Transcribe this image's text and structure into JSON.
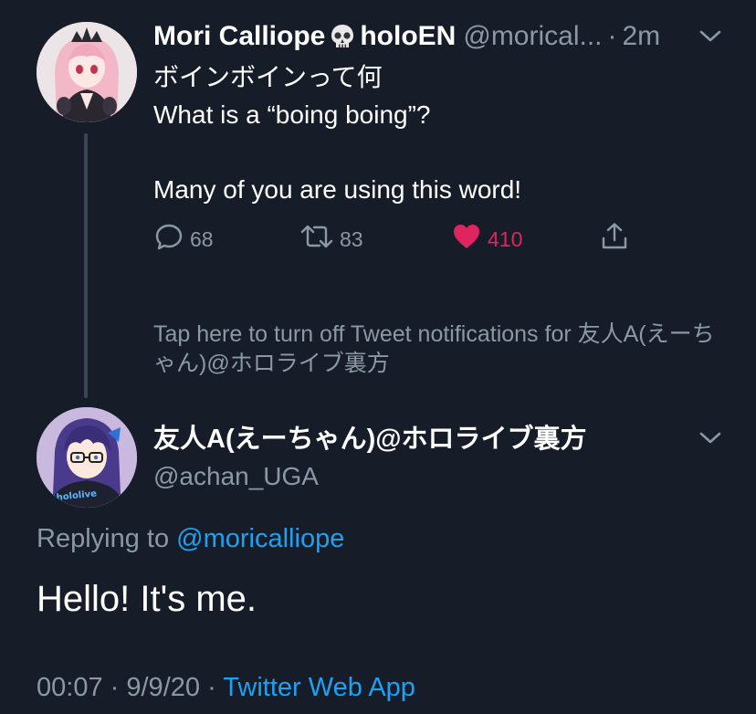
{
  "tweet1": {
    "display_name": "Mori Calliope",
    "name_emoji": "skull",
    "name_suffix": "holoEN",
    "handle": "@morical...",
    "separator": "·",
    "time": "2m",
    "lines": [
      "ボインボインって何",
      "What is a “boing boing”?",
      "",
      "Many of you are using this word!"
    ],
    "actions": {
      "reply_count": "68",
      "retweet_count": "83",
      "like_count": "410"
    },
    "colors": {
      "like": "#e0245e",
      "muted": "#8b98a5",
      "link": "#1da1f2",
      "background": "#161d29"
    }
  },
  "notification": {
    "text": "Tap here to turn off Tweet notifications for 友人A(えーちゃん)@ホロライブ裏方"
  },
  "tweet2": {
    "display_name": "友人A(えーちゃん)@ホロライブ裏方",
    "handle": "@achan_UGA",
    "replying_prefix": "Replying to",
    "replying_to": "@moricalliope",
    "text": "Hello! It's me.",
    "time": "00:07",
    "date": "9/9/20",
    "separator": "·",
    "source": "Twitter Web App",
    "avatar_shirt_text": "hololive"
  }
}
